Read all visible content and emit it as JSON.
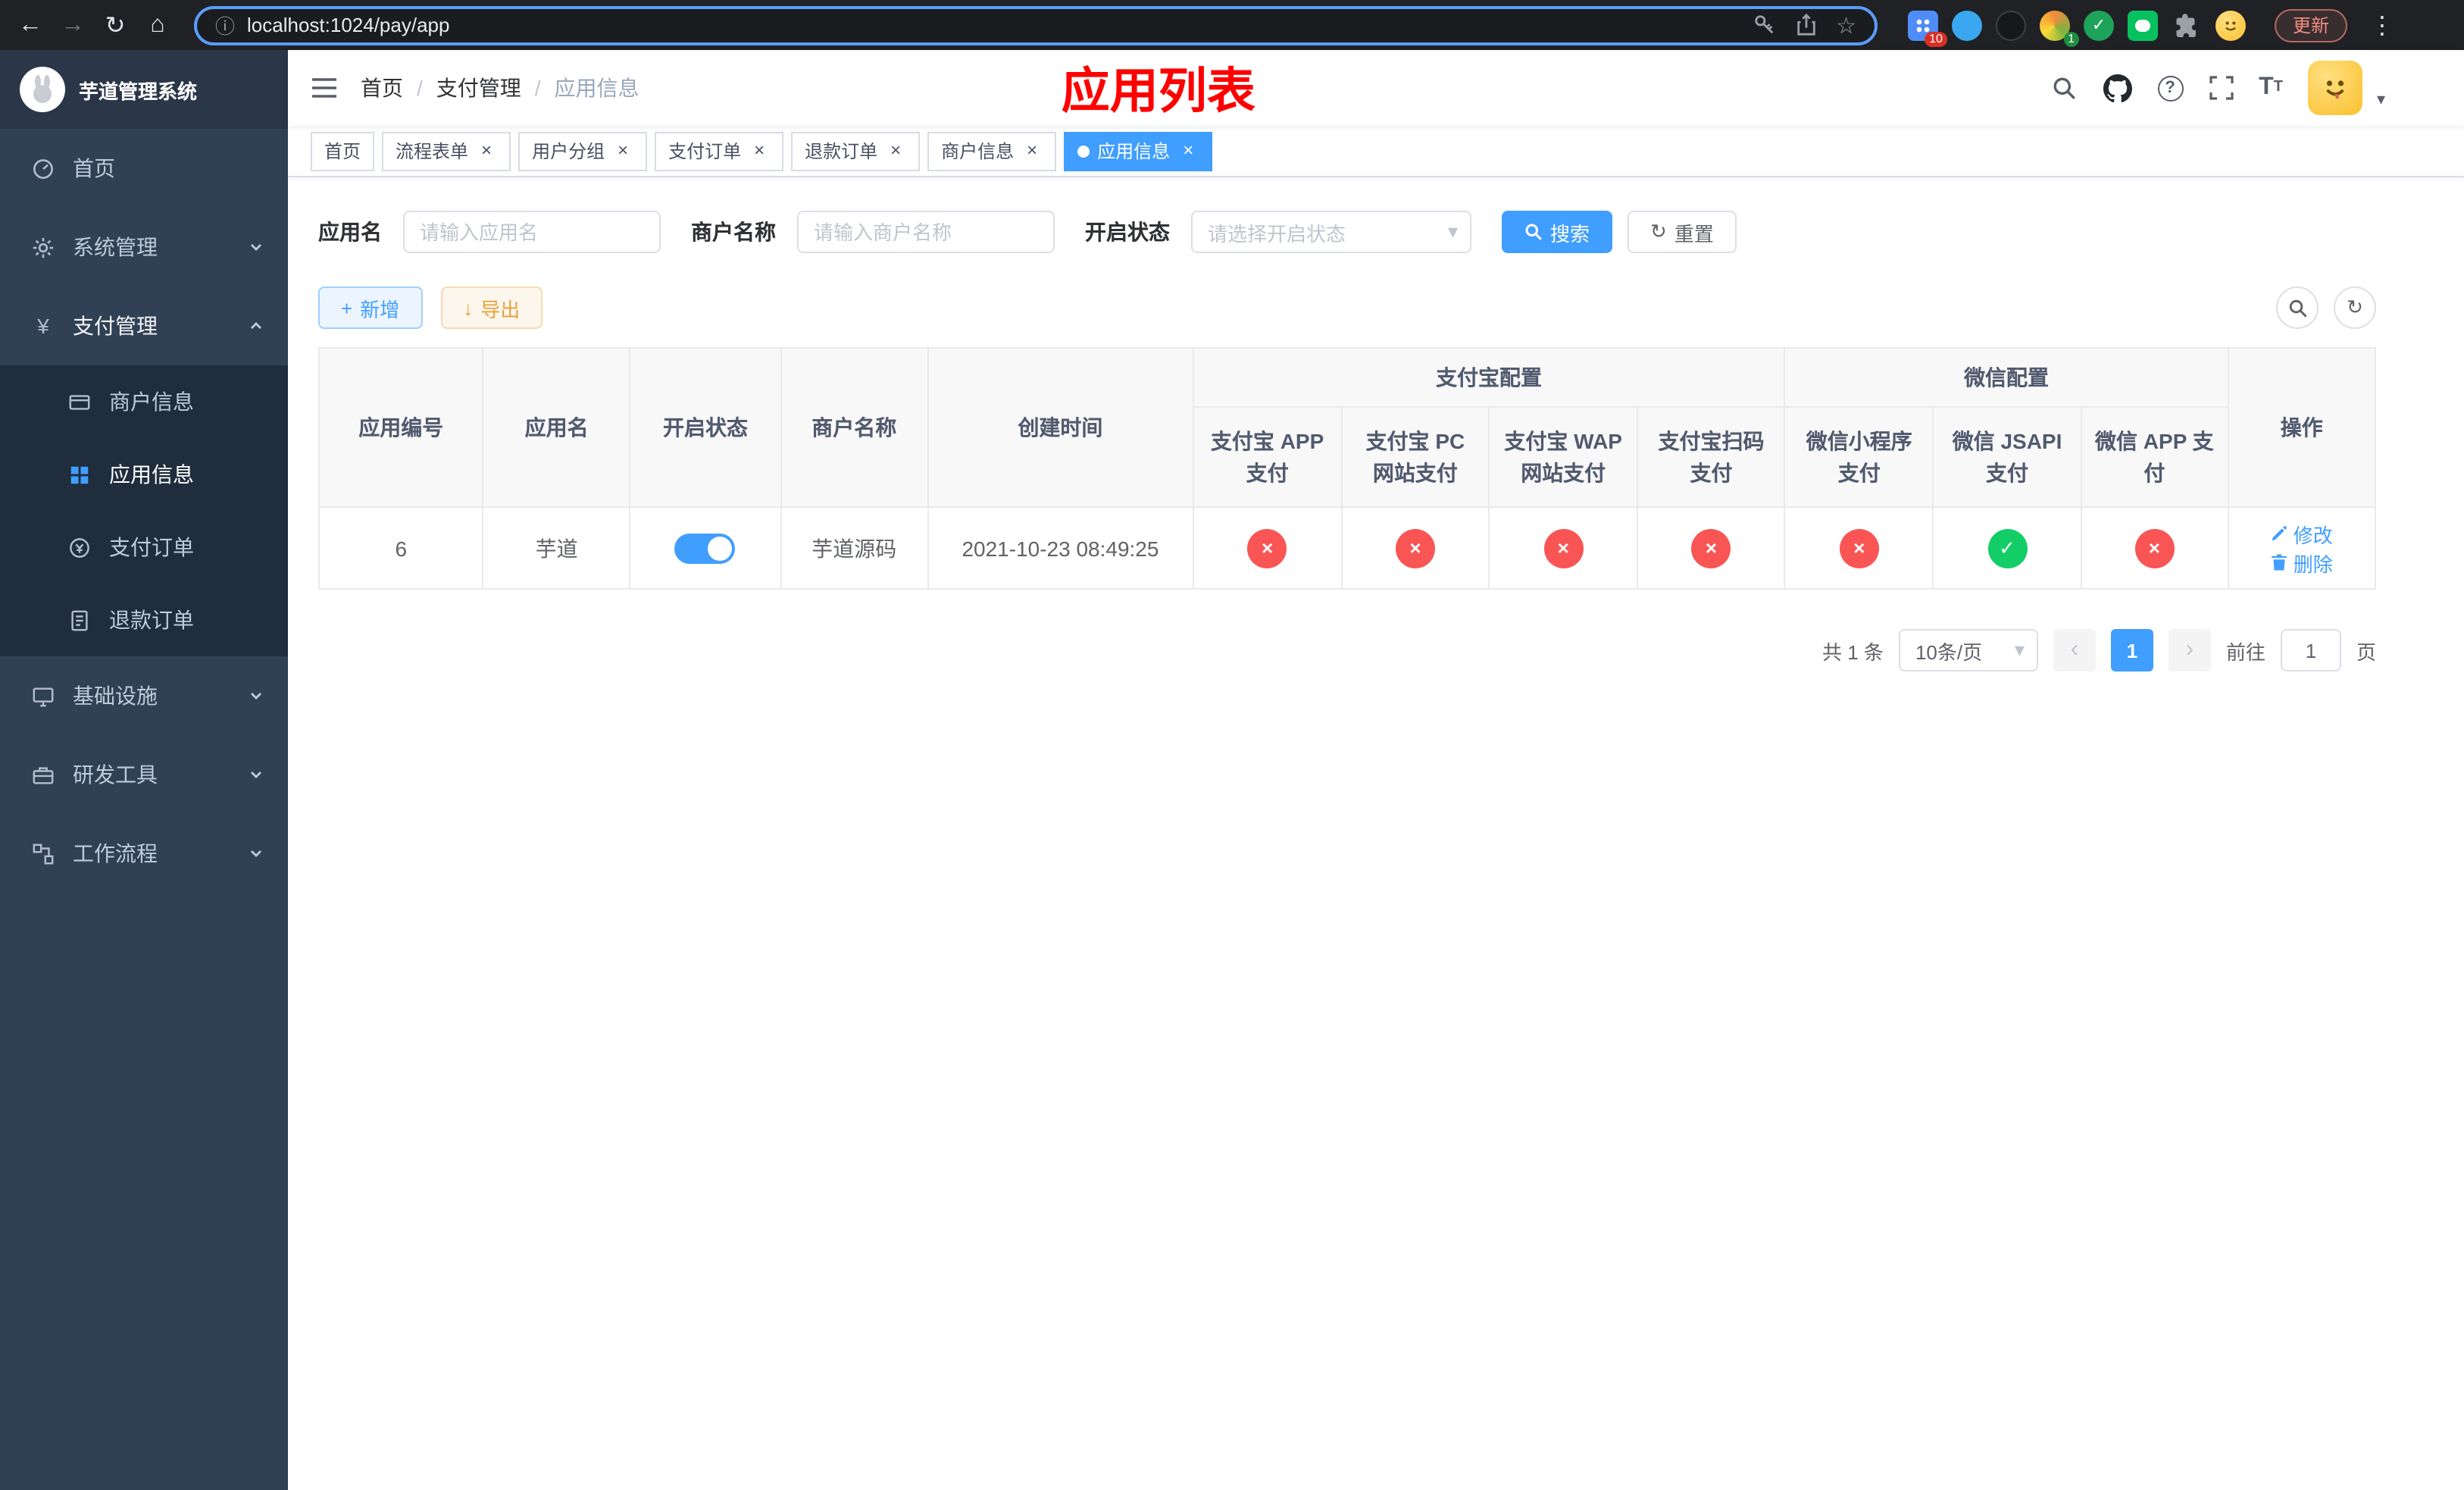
{
  "colors": {
    "primary": "#409eff",
    "success": "#13ce66",
    "danger": "#fa5555",
    "warning": "#e6a23c",
    "title_red": "#ff0000",
    "sidebar_bg": "#304156",
    "submenu_bg": "#1f2d3d",
    "chrome_bg": "#202124"
  },
  "icons": {
    "back": "←",
    "forward": "→",
    "reload": "↻",
    "home": "⌂",
    "info": "ⓘ",
    "star": "☆",
    "more": "⋮",
    "close": "×",
    "check": "✓",
    "cross": "×",
    "caret_down": "▾",
    "plus": "+",
    "download": "↓",
    "refresh": "↻",
    "prev": "‹",
    "next": "›",
    "question": "?",
    "yen": "¥",
    "font_size": "T",
    "sep": "/"
  },
  "browser": {
    "url": "localhost:1024/pay/app",
    "update_label": "更新",
    "badges": {
      "extension_1": "10",
      "avatar": "1"
    }
  },
  "sidebar": {
    "title": "芋道管理系统",
    "menu": {
      "home": "首页",
      "system": "系统管理",
      "payment": "支付管理",
      "merchant_info": "商户信息",
      "app_info": "应用信息",
      "pay_order": "支付订单",
      "refund_order": "退款订单",
      "infra": "基础设施",
      "dev_tools": "研发工具",
      "workflow": "工作流程"
    }
  },
  "header": {
    "breadcrumb": [
      "首页",
      "支付管理",
      "应用信息"
    ],
    "page_title": "应用列表"
  },
  "tabs": [
    {
      "label": "首页"
    },
    {
      "label": "流程表单"
    },
    {
      "label": "用户分组"
    },
    {
      "label": "支付订单"
    },
    {
      "label": "退款订单"
    },
    {
      "label": "商户信息"
    },
    {
      "label": "应用信息"
    }
  ],
  "filters": {
    "app_name_label": "应用名",
    "app_name_placeholder": "请输入应用名",
    "merchant_label": "商户名称",
    "merchant_placeholder": "请输入商户名称",
    "status_label": "开启状态",
    "status_placeholder": "请选择开启状态",
    "search_label": "搜索",
    "reset_label": "重置"
  },
  "toolbar": {
    "add_label": "新增",
    "export_label": "导出"
  },
  "table": {
    "headers": {
      "app_id": "应用编号",
      "app_name": "应用名",
      "status": "开启状态",
      "merchant_name": "商户名称",
      "create_time": "创建时间",
      "alipay_group": "支付宝配置",
      "wechat_group": "微信配置",
      "alipay_app": "支付宝 APP 支付",
      "alipay_pc": "支付宝 PC 网站支付",
      "alipay_wap": "支付宝 WAP 网站支付",
      "alipay_qr": "支付宝扫码支付",
      "wechat_mini": "微信小程序支付",
      "wechat_jsapi": "微信 JSAPI 支付",
      "wechat_app": "微信 APP 支付",
      "actions": "操作"
    },
    "rows": [
      {
        "id": "6",
        "name": "芋道",
        "enabled": true,
        "merchant": "芋道源码",
        "created": "2021-10-23 08:49:25",
        "statuses": [
          false,
          false,
          false,
          false,
          false,
          true,
          false
        ],
        "edit_label": "修改",
        "delete_label": "删除"
      }
    ]
  },
  "pagination": {
    "total": "共 1 条",
    "page_size": "10条/页",
    "page": "1",
    "goto_label": "前往",
    "goto_value": "1",
    "unit_label": "页"
  }
}
